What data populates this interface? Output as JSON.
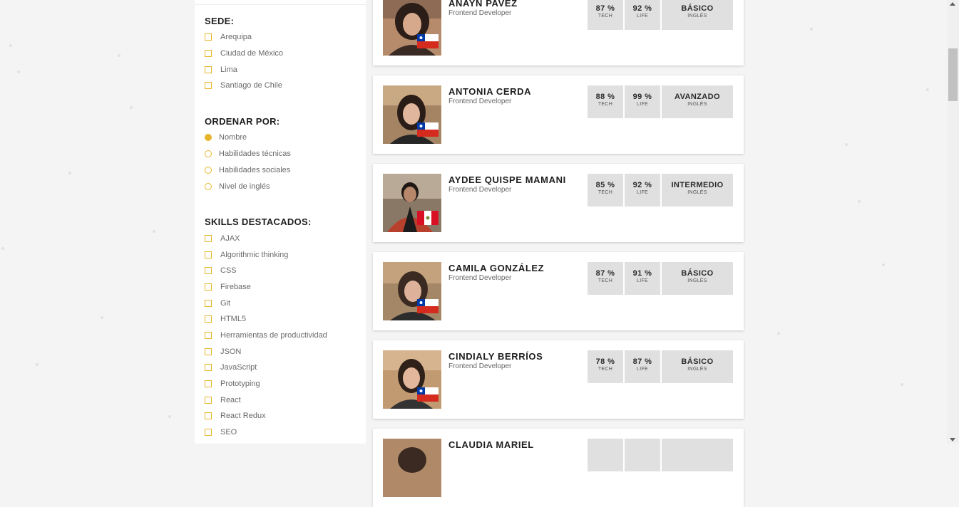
{
  "sidebar": {
    "sede": {
      "title": "SEDE:",
      "options": [
        "Arequipa",
        "Ciudad de México",
        "Lima",
        "Santiago de Chile"
      ]
    },
    "ordenar": {
      "title": "ORDENAR POR:",
      "options": [
        "Nombre",
        "Habilidades técnicas",
        "Habilidades sociales",
        "Nivel de inglés"
      ],
      "selected": "Nombre"
    },
    "skills": {
      "title": "SKILLS DESTACADOS:",
      "options": [
        "AJAX",
        "Algorithmic thinking",
        "CSS",
        "Firebase",
        "Git",
        "HTML5",
        "Herramientas de productividad",
        "JSON",
        "JavaScript",
        "Prototyping",
        "React",
        "React Redux",
        "SEO"
      ]
    }
  },
  "stat_labels": {
    "tech": "TECH",
    "life": "LIFE",
    "english": "INGLÉS"
  },
  "students": [
    {
      "name": "ANAYN PAVEZ",
      "role": "Frontend Developer",
      "tech": "87 %",
      "life": "92 %",
      "english": "BÁSICO",
      "flag": "chile"
    },
    {
      "name": "ANTONIA CERDA",
      "role": "Frontend Developer",
      "tech": "88 %",
      "life": "99 %",
      "english": "AVANZADO",
      "flag": "chile"
    },
    {
      "name": "AYDEE QUISPE MAMANI",
      "role": "Frontend Developer",
      "tech": "85 %",
      "life": "92 %",
      "english": "INTERMEDIO",
      "flag": "peru"
    },
    {
      "name": "CAMILA GONZÁLEZ",
      "role": "Frontend Developer",
      "tech": "87 %",
      "life": "91 %",
      "english": "BÁSICO",
      "flag": "chile"
    },
    {
      "name": "CINDIALY BERRÍOS",
      "role": "Frontend Developer",
      "tech": "78 %",
      "life": "87 %",
      "english": "BÁSICO",
      "flag": "chile"
    },
    {
      "name": "CLAUDIA MARIEL",
      "role": "",
      "tech": "",
      "life": "",
      "english": "",
      "flag": ""
    }
  ],
  "colors": {
    "accent": "#e7b52c",
    "stat_bg": "#e0e0e0",
    "page_bg": "#f4f4f4"
  }
}
